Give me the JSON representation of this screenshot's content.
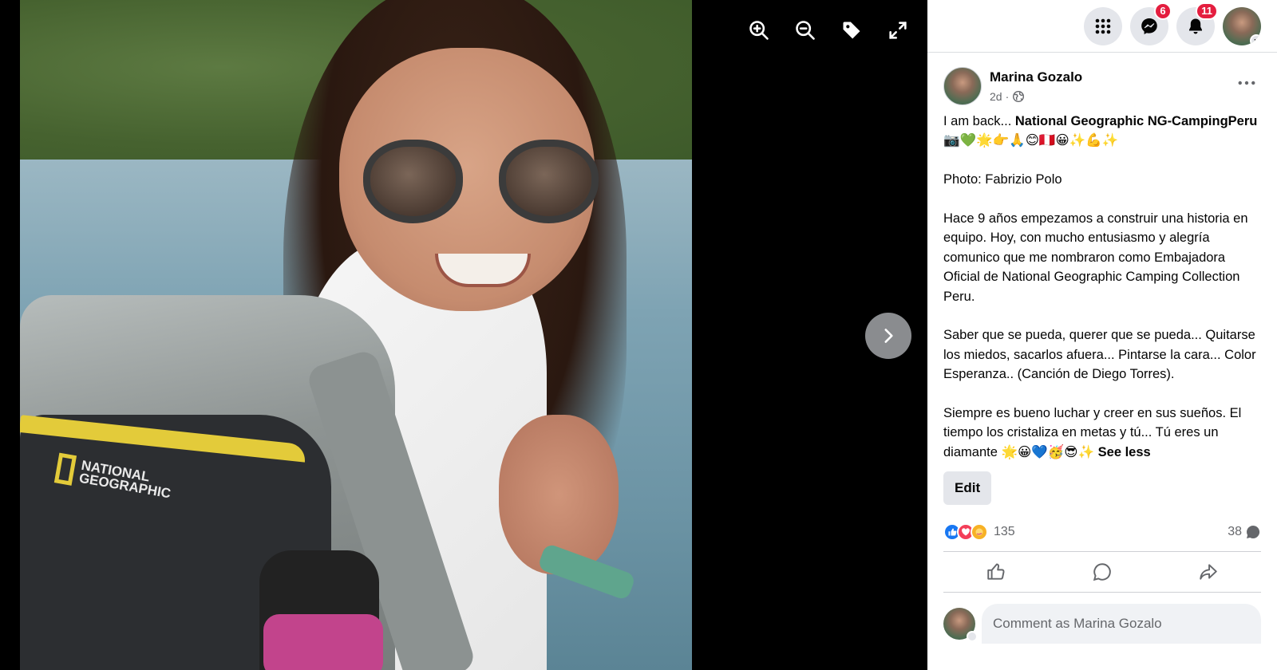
{
  "viewer": {
    "photo_logo": [
      "NATIONAL",
      "GEOGRAPHIC"
    ],
    "tools": [
      "zoom-in-icon",
      "zoom-out-icon",
      "tag-icon",
      "fullscreen-icon"
    ],
    "next_icon": "chevron-right-icon"
  },
  "topbar": {
    "menu_icon": "grid-menu-icon",
    "messenger_badge": "6",
    "notifications_badge": "11"
  },
  "post": {
    "author": "Marina Gozalo",
    "time": "2d",
    "privacy_icon": "globe-icon",
    "intro_text": "I am back... ",
    "intro_bold": "National Geographic NG-CampingPeru",
    "intro_emojis": "📷💚🌟👉🙏😊🇵🇪😀✨💪✨",
    "photo_credit": "Photo: Fabrizio Polo",
    "paragraph_2": "Hace 9 años empezamos a construir una historia en equipo. Hoy, con mucho entusiasmo y alegría comunico que me nombraron como Embajadora Oficial de National Geographic Camping Collection Peru.",
    "paragraph_3": "Saber que se pueda, querer que se pueda... Quitarse los miedos, sacarlos afuera... Pintarse la cara... Color Esperanza.. (Canción de Diego Torres).",
    "paragraph_4": "Siempre es bueno luchar y creer en sus sueños. El tiempo los cristaliza en metas y tú... Tú eres un diamante ",
    "paragraph_4_emojis": "🌟😀💙🥳😎✨ ",
    "see_less": "See less",
    "edit_label": "Edit",
    "reaction_count": "135",
    "comment_count": "38",
    "comment_placeholder": "Comment as Marina Gozalo"
  },
  "colors": {
    "accent": "#1877f2",
    "badge": "#e41e3f",
    "button_bg": "#e4e6eb"
  }
}
